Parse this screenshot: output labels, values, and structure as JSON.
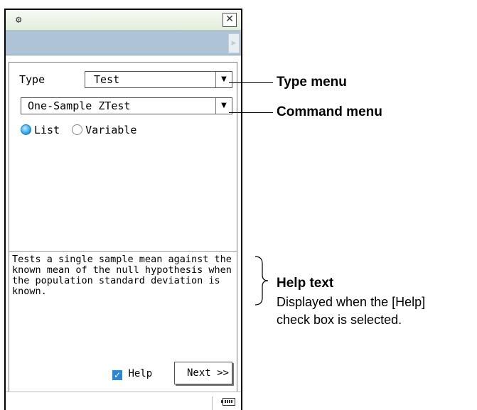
{
  "toolbar": {
    "arrow_glyph": "▶"
  },
  "dialog": {
    "type_label": "Type",
    "type_value": "Test",
    "command_value": "One-Sample ZTest",
    "dropdown_glyph": "▼",
    "radio_options": [
      "List",
      "Variable"
    ],
    "radio_selected": "List",
    "help_text": "Tests a single sample mean against the known mean of the null hypothesis when the population standard deviation is known.",
    "help_checkbox_label": "Help",
    "help_checked": true,
    "next_label": "Next >>"
  },
  "annotations": {
    "type_menu": "Type menu",
    "command_menu": "Command menu",
    "help_title": "Help text",
    "help_desc_1": "Displayed when the [Help]",
    "help_desc_2": "check box is selected."
  },
  "icons": {
    "settings": "gear-icon",
    "close": "close-icon",
    "battery": "battery-icon"
  }
}
